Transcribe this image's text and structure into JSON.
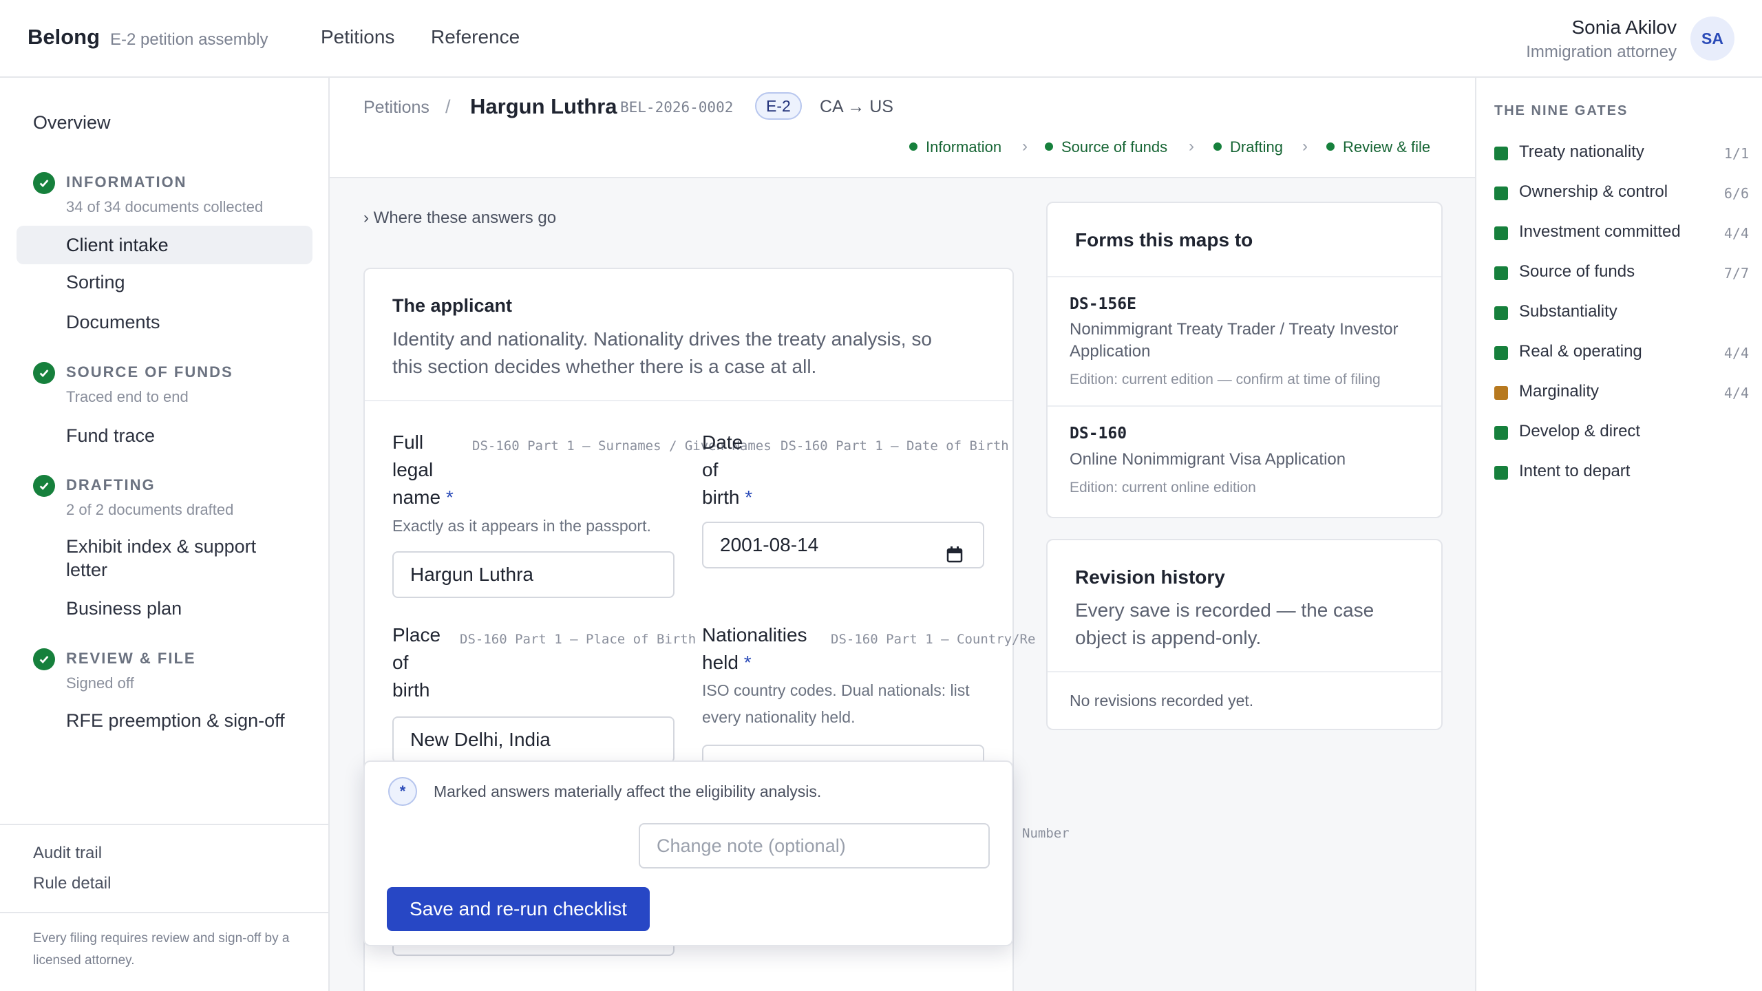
{
  "header": {
    "brand": "Belong",
    "brand_sub": "E-2 petition assembly",
    "nav": [
      "Petitions",
      "Reference"
    ],
    "user_name": "Sonia Akilov",
    "user_role": "Immigration attorney",
    "avatar_initials": "SA"
  },
  "sidebar": {
    "overview": "Overview",
    "sections": [
      {
        "heading": "INFORMATION",
        "meta": "34 of 34 documents collected",
        "items": [
          "Client intake",
          "Sorting",
          "Documents"
        ]
      },
      {
        "heading": "SOURCE OF FUNDS",
        "meta": "Traced end to end",
        "items": [
          "Fund trace"
        ]
      },
      {
        "heading": "DRAFTING",
        "meta": "2 of 2 documents drafted",
        "items": [
          "Exhibit index & support letter",
          "Business plan"
        ]
      },
      {
        "heading": "REVIEW & FILE",
        "meta": "Signed off",
        "items": [
          "RFE preemption & sign-off"
        ]
      }
    ],
    "active_item": "Client intake",
    "bottom_links": [
      "Audit trail",
      "Rule detail"
    ],
    "footer_note": "Every filing requires review and sign-off by a licensed attorney."
  },
  "breadcrumb": {
    "root": "Petitions",
    "separator": "/",
    "client": "Hargun Luthra",
    "case_id": "BEL-2026-0002",
    "visa": "E-2",
    "route": "CA → US"
  },
  "steps": [
    "Information",
    "Source of funds",
    "Drafting",
    "Review & file"
  ],
  "where_link": "› Where these answers go",
  "applicant": {
    "title": "The applicant",
    "description": "Identity and nationality. Nationality drives the treaty analysis, so this section decides whether there is a case at all.",
    "fields": {
      "full_name": {
        "label_lines": [
          "Full",
          "legal",
          "name"
        ],
        "required": "*",
        "map": "DS-160 Part 1 — Surnames / Given Names",
        "hint": "Exactly as it appears in the passport.",
        "value": "Hargun Luthra"
      },
      "dob": {
        "label_lines": [
          "Date",
          "of",
          "birth"
        ],
        "required": "*",
        "map": "DS-160 Part 1 — Date of Birth",
        "value": "2001-08-14"
      },
      "pob": {
        "label_lines": [
          "Place",
          "of",
          "birth"
        ],
        "map": "DS-160 Part 1 — Place of Birth",
        "value": "New Delhi, India"
      },
      "nationalities": {
        "label_lines": [
          "Nationalities",
          "held"
        ],
        "required": "*",
        "map": "DS-160 Part 1 — Country/Re",
        "hint": "ISO country codes. Dual nationals: list every nationality held."
      }
    }
  },
  "stray_label": "Number",
  "forms": {
    "title": "Forms this maps to",
    "items": [
      {
        "code": "DS-156E",
        "name": "Nonimmigrant Treaty Trader / Treaty Investor Application",
        "edition": "Edition: current edition — confirm at time of filing"
      },
      {
        "code": "DS-160",
        "name": "Online Nonimmigrant Visa Application",
        "edition": "Edition: current online edition"
      }
    ]
  },
  "revisions": {
    "title": "Revision history",
    "description": "Every save is recorded — the case object is append-only.",
    "empty": "No revisions recorded yet."
  },
  "save_panel": {
    "star": "*",
    "note": "Marked answers materially affect the eligibility analysis.",
    "change_placeholder": "Change note (optional)",
    "save_label": "Save and re-run checklist"
  },
  "gates": {
    "title": "THE NINE GATES",
    "items": [
      {
        "label": "Treaty nationality",
        "count": "1/1",
        "color": "#16803c"
      },
      {
        "label": "Ownership & control",
        "count": "6/6",
        "color": "#16803c"
      },
      {
        "label": "Investment committed",
        "count": "4/4",
        "color": "#16803c"
      },
      {
        "label": "Source of funds",
        "count": "7/7",
        "color": "#16803c"
      },
      {
        "label": "Substantiality",
        "count": "",
        "color": "#16803c"
      },
      {
        "label": "Real & operating",
        "count": "4/4",
        "color": "#16803c"
      },
      {
        "label": "Marginality",
        "count": "4/4",
        "color": "#b7791f"
      },
      {
        "label": "Develop & direct",
        "count": "",
        "color": "#16803c"
      },
      {
        "label": "Intent to depart",
        "count": "",
        "color": "#16803c"
      }
    ]
  }
}
